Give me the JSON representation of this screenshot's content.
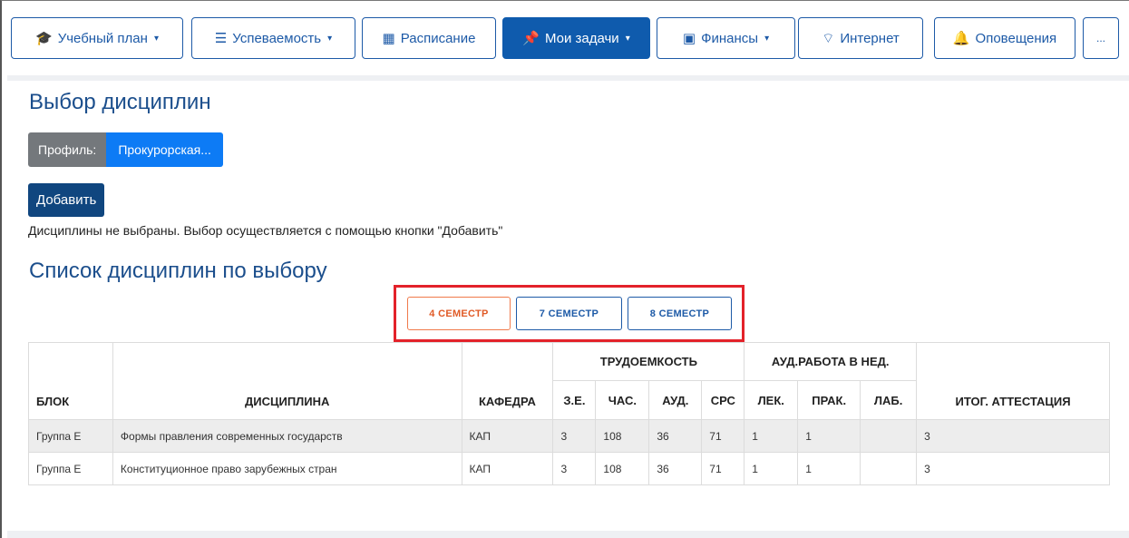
{
  "nav": {
    "items": [
      {
        "label": "Учебный план",
        "icon": "graduation-cap-icon",
        "glyph": "🎓",
        "caret": true,
        "active": false
      },
      {
        "label": "Успеваемость",
        "icon": "list-icon",
        "glyph": "☰",
        "caret": true,
        "active": false
      },
      {
        "label": "Расписание",
        "icon": "calendar-icon",
        "glyph": "▦",
        "caret": false,
        "active": false
      },
      {
        "label": "Мои задачи",
        "icon": "pin-icon",
        "glyph": "📌",
        "caret": true,
        "active": true
      },
      {
        "label": "Финансы",
        "icon": "money-icon",
        "glyph": "▣",
        "caret": true,
        "active": false
      },
      {
        "label": "Интернет",
        "icon": "wifi-icon",
        "glyph": "⌔",
        "caret": false,
        "active": false
      },
      {
        "label": "Оповещения",
        "icon": "bell-icon",
        "glyph": "🔔",
        "caret": false,
        "active": false
      },
      {
        "label": "...",
        "icon": "",
        "glyph": "",
        "caret": false,
        "active": false
      }
    ],
    "caret_glyph": "▾"
  },
  "page": {
    "title": "Выбор дисциплин",
    "profile_label": "Профиль:",
    "profile_value": "Прокурорская...",
    "add_button": "Добавить",
    "note": "Дисциплины не выбраны. Выбор осуществляется с помощью кнопки \"Добавить\"",
    "list_title": "Список дисциплин по выбору"
  },
  "semesters": [
    {
      "label": "4 СЕМЕСТР",
      "active": true
    },
    {
      "label": "7 СЕМЕСТР",
      "active": false
    },
    {
      "label": "8 СЕМЕСТР",
      "active": false
    }
  ],
  "table": {
    "group_headers": {
      "labor": "ТРУДОЕМКОСТЬ",
      "weekly": "АУД.РАБОТА В НЕД."
    },
    "columns": [
      "БЛОК",
      "ДИСЦИПЛИНА",
      "КАФЕДРА",
      "З.Е.",
      "ЧАС.",
      "АУД.",
      "СРС",
      "ЛЕК.",
      "ПРАК.",
      "ЛАБ.",
      "ИТОГ. АТТЕСТАЦИЯ"
    ],
    "rows": [
      [
        "Группа Е",
        "Формы правления современных государств",
        "КАП",
        "3",
        "108",
        "36",
        "71",
        "1",
        "1",
        "",
        "3"
      ],
      [
        "Группа Е",
        "Конституционное право зарубежных стран",
        "КАП",
        "3",
        "108",
        "36",
        "71",
        "1",
        "1",
        "",
        "3"
      ]
    ]
  },
  "colors": {
    "primary": "#1d5aa7",
    "active_nav": "#0f5bad",
    "profile_value": "#0d7bf5",
    "highlight_box": "#e3222a",
    "active_semester": "#e05a26"
  }
}
